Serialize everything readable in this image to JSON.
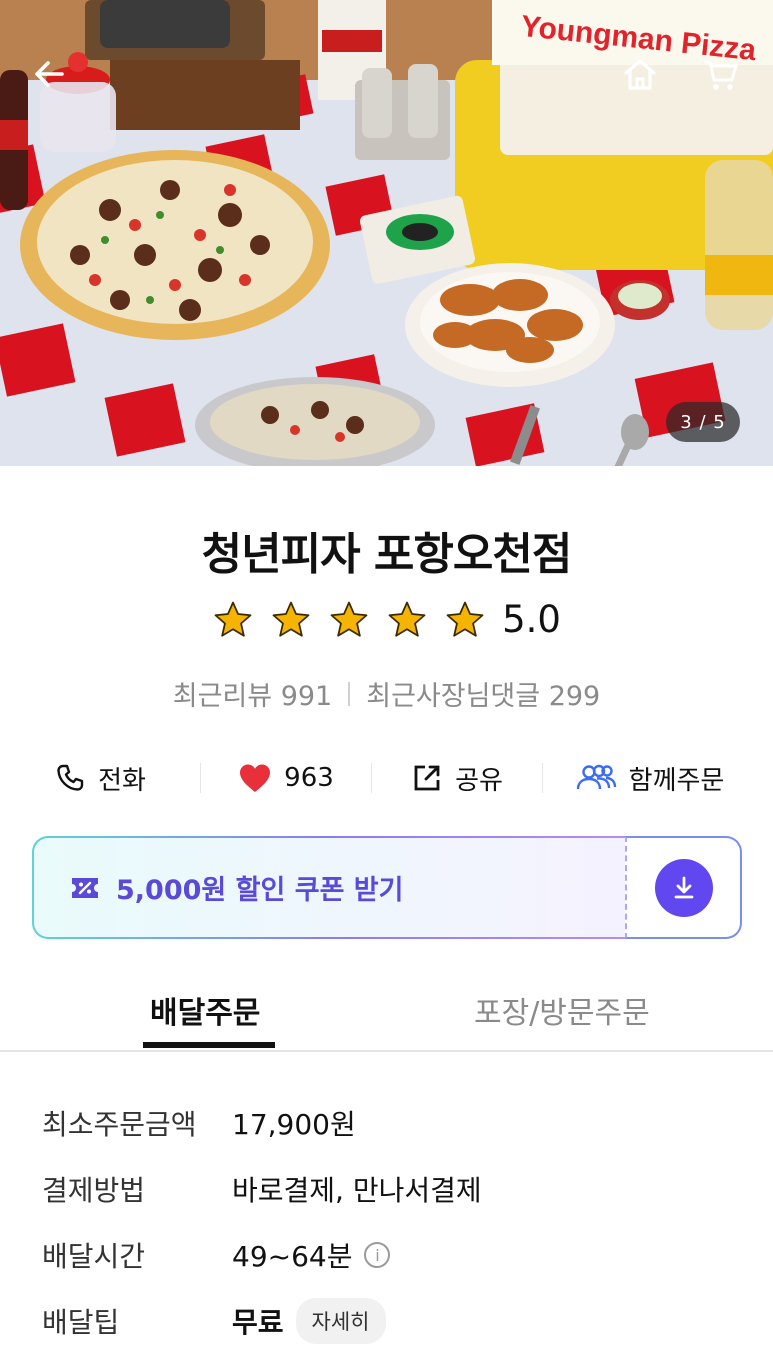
{
  "hero": {
    "sign_text": "Youngman Pizza",
    "counter": "3 / 5"
  },
  "store": {
    "name": "청년피자 포항오천점",
    "rating": "5.0",
    "recent_reviews": "최근리뷰 991",
    "owner_replies": "최근사장님댓글 299"
  },
  "actions": {
    "call": "전화",
    "likes": "963",
    "share": "공유",
    "group_order": "함께주문"
  },
  "coupon": {
    "label": "5,000원 할인 쿠폰 받기"
  },
  "tabs": [
    {
      "label": "배달주문",
      "active": true
    },
    {
      "label": "포장/방문주문",
      "active": false
    }
  ],
  "info": {
    "min_order_label": "최소주문금액",
    "min_order_value": "17,900원",
    "payment_label": "결제방법",
    "payment_value": "바로결제, 만나서결제",
    "delivery_time_label": "배달시간",
    "delivery_time_value": "49~64분",
    "tip_label": "배달팁",
    "tip_value": "무료",
    "tip_detail": "자세히"
  },
  "colors": {
    "accent_purple": "#6047ef",
    "coupon_text": "#5b49d8",
    "heart_red": "#e8303a",
    "group_blue": "#3a6cf4",
    "star_gold": "#f5b400"
  }
}
